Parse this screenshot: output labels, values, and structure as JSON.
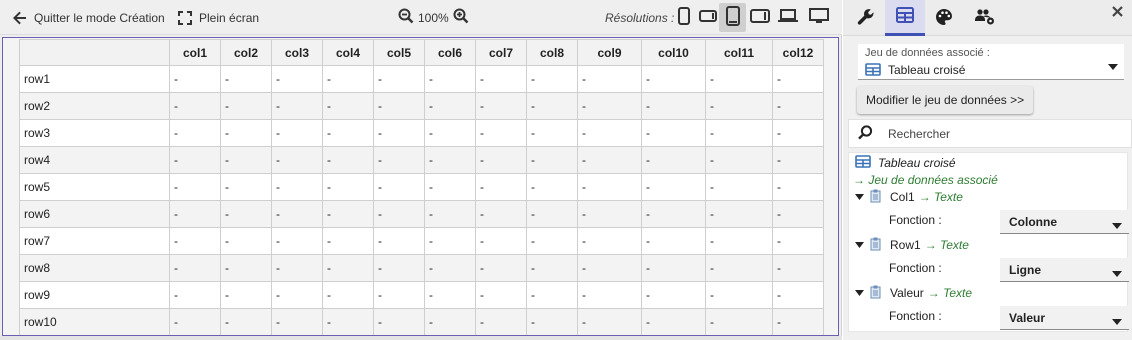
{
  "toolbar": {
    "quit_label": "Quitter le mode Création",
    "fullscreen_label": "Plein écran",
    "zoom_value": "100%",
    "resolutions_label": "Résolutions :"
  },
  "table": {
    "columns": [
      "col1",
      "col2",
      "col3",
      "col4",
      "col5",
      "col6",
      "col7",
      "col8",
      "col9",
      "col10",
      "col11",
      "col12"
    ],
    "rows": [
      "row1",
      "row2",
      "row3",
      "row4",
      "row5",
      "row6",
      "row7",
      "row8",
      "row9",
      "row10"
    ],
    "empty_cell": "-"
  },
  "panel": {
    "tabs": [
      "wrench-icon",
      "table-icon",
      "palette-icon",
      "users-icon"
    ],
    "dataset": {
      "label": "Jeu de données associé :",
      "value": "Tableau croisé"
    },
    "modify_button": "Modifier le jeu de données >>",
    "search_placeholder": "Rechercher",
    "tree": {
      "root_label": "Tableau croisé",
      "assoc_label": "→ Jeu de données associé",
      "function_label": "Fonction :",
      "fields": [
        {
          "name": "Col1",
          "type": "→ Texte",
          "function": "Colonne"
        },
        {
          "name": "Row1",
          "type": "→ Texte",
          "function": "Ligne"
        },
        {
          "name": "Valeur",
          "type": "→ Texte",
          "function": "Valeur"
        }
      ]
    }
  },
  "colors": {
    "accent": "#3f51b5",
    "frame": "#6a5fb2",
    "type_green": "#2e7d32"
  }
}
